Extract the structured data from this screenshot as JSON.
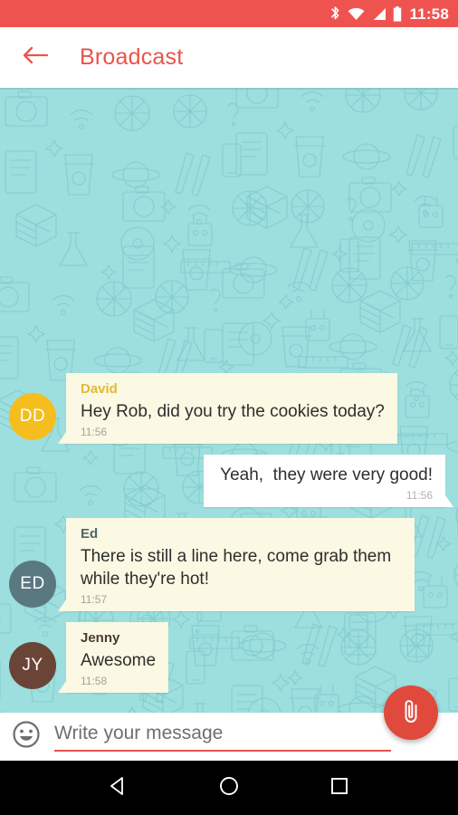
{
  "status_bar": {
    "time": "11:58",
    "background_color": "#EF5350",
    "icons": [
      "bluetooth-icon",
      "wifi-icon",
      "cell-signal-icon",
      "battery-icon"
    ]
  },
  "toolbar": {
    "title": "Broadcast",
    "back_icon": "back-arrow-icon",
    "title_color": "#E8544B",
    "background_color": "#FFFFFF"
  },
  "chat": {
    "background_color": "#9DDEDE",
    "messages": [
      {
        "id": "msg-david",
        "direction": "incoming",
        "sender": "David",
        "sender_color": "#E3B937",
        "text": "Hey Rob, did you try the cookies today?",
        "time": "11:56",
        "avatar": {
          "initials": "DD",
          "color": "#F5BE1E"
        }
      },
      {
        "id": "msg-self",
        "direction": "outgoing",
        "sender": "",
        "sender_color": "",
        "text": "Yeah,  they were very good!",
        "time": "11:56",
        "avatar": null
      },
      {
        "id": "msg-ed",
        "direction": "incoming",
        "sender": "Ed",
        "sender_color": "#4D666C",
        "text": "There is still a line here, come grab them while they're hot!",
        "time": "11:57",
        "avatar": {
          "initials": "ED",
          "color": "#5A7880"
        }
      },
      {
        "id": "msg-jenny",
        "direction": "incoming",
        "sender": "Jenny",
        "sender_color": "#4A3A33",
        "text": "Awesome",
        "time": "11:58",
        "avatar": {
          "initials": "JY",
          "color": "#6B4438"
        }
      }
    ]
  },
  "attach_fab": {
    "icon": "paperclip-icon",
    "color": "#E04A3C"
  },
  "input_bar": {
    "emoji_icon": "emoji-smiley-icon",
    "placeholder": "Write your message",
    "value": "",
    "underline_color": "#E0544A"
  },
  "nav_bar": {
    "background_color": "#000000",
    "buttons": [
      "nav-back-icon",
      "nav-home-icon",
      "nav-recents-icon"
    ]
  }
}
